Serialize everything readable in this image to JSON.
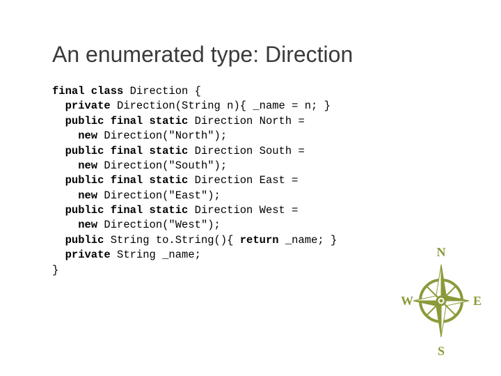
{
  "title": "An enumerated type: Direction",
  "code": {
    "l1a": "final class ",
    "l1b": "Direction {",
    "l2a": "  private ",
    "l2b": "Direction(String n){ _name = n; }",
    "l3a": "  public final static ",
    "l3b": "Direction North =",
    "l4a": "    new ",
    "l4b": "Direction(\"North\");",
    "l5a": "  public final static ",
    "l5b": "Direction South =",
    "l6a": "    new ",
    "l6b": "Direction(\"South\");",
    "l7a": "  public final static ",
    "l7b": "Direction East =",
    "l8a": "    new ",
    "l8b": "Direction(\"East\");",
    "l9a": "  public final static ",
    "l9b": "Direction West =",
    "l10a": "    new ",
    "l10b": "Direction(\"West\");",
    "l11a": "  public ",
    "l11b": "String to.String(){ ",
    "l11c": "return ",
    "l11d": "_name; }",
    "l12a": "  private ",
    "l12b": "String _name;",
    "l13": "}"
  },
  "compass": {
    "n": "N",
    "s": "S",
    "e": "E",
    "w": "W",
    "color": "#8a9a3a"
  }
}
